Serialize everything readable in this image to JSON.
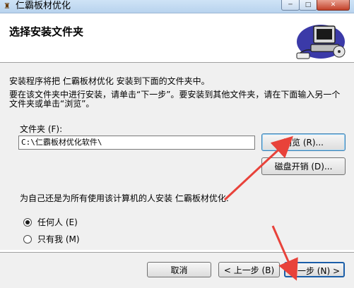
{
  "window": {
    "title": "仁霸板材优化",
    "icon": "installer-icon",
    "controls": [
      "minimize-icon",
      "maximize-icon",
      "close-icon"
    ],
    "close_glyph": "✕",
    "min_glyph": "─",
    "max_glyph": "□"
  },
  "header": {
    "title": "选择安装文件夹",
    "graphic": "computer-install-icon"
  },
  "body": {
    "intro": "安装程序将把 仁霸板材优化 安装到下面的文件夹中。",
    "instructions": "要在该文件夹中进行安装，请单击“下一步”。要安装到其他文件夹，请在下面输入另一个文件夹或单击“浏览”。",
    "folder_label": "文件夹 (F):",
    "folder_value": "C:\\仁霸板材优化软件\\",
    "browse_label": "浏览 (R)...",
    "disk_cost_label": "磁盘开销 (D)...",
    "question": "为自己还是为所有使用该计算机的人安装 仁霸板材优化:",
    "radio_everyone": "任何人 (E)",
    "radio_me": "只有我 (M)",
    "selected": "everyone"
  },
  "footer": {
    "cancel_label": "取消",
    "back_label": "< 上一步 (B)",
    "next_label": "下一步 (N) >"
  },
  "colors": {
    "annotation_arrow": "#e8423a"
  }
}
